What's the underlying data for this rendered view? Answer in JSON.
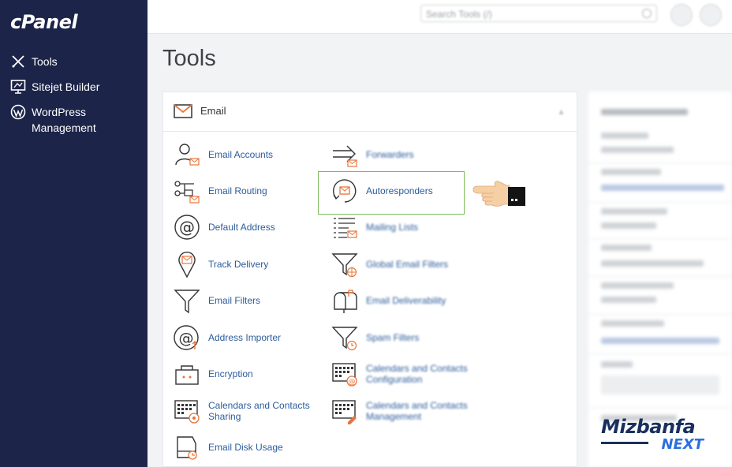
{
  "brand": {
    "logo": "cPanel"
  },
  "sidebar": {
    "items": [
      {
        "label": "Tools",
        "icon": "tools-icon"
      },
      {
        "label": "Sitejet Builder",
        "icon": "monitor-icon"
      },
      {
        "label": "WordPress Management",
        "icon": "wordpress-icon"
      }
    ]
  },
  "topbar": {
    "search_placeholder": "Search Tools (/)"
  },
  "page": {
    "title": "Tools"
  },
  "section": {
    "title": "Email",
    "tools_left": [
      {
        "label": "Email Accounts",
        "icon": "email-accounts-icon"
      },
      {
        "label": "Email Routing",
        "icon": "email-routing-icon"
      },
      {
        "label": "Default Address",
        "icon": "at-sign-icon"
      },
      {
        "label": "Track Delivery",
        "icon": "location-pin-icon"
      },
      {
        "label": "Email Filters",
        "icon": "funnel-icon"
      },
      {
        "label": "Address Importer",
        "icon": "address-importer-icon"
      },
      {
        "label": "Encryption",
        "icon": "lock-icon"
      },
      {
        "label": "Calendars and Contacts Sharing",
        "icon": "calendar-sharing-icon"
      },
      {
        "label": "Email Disk Usage",
        "icon": "disk-usage-icon"
      }
    ],
    "tools_right": [
      {
        "label": "Forwarders",
        "icon": "forwarders-icon"
      },
      {
        "label": "Autoresponders",
        "icon": "autoresponders-icon"
      },
      {
        "label": "Mailing Lists",
        "icon": "mailing-lists-icon"
      },
      {
        "label": "Global Email Filters",
        "icon": "global-filter-icon"
      },
      {
        "label": "Email Deliverability",
        "icon": "mailbox-icon"
      },
      {
        "label": "Spam Filters",
        "icon": "spam-filter-icon"
      },
      {
        "label": "Calendars and Contacts Configuration",
        "icon": "calendar-config-icon"
      },
      {
        "label": "Calendars and Contacts Management",
        "icon": "calendar-management-icon"
      }
    ]
  },
  "watermark": {
    "top": "Mizbanfa",
    "bottom": "NEXT"
  },
  "colors": {
    "sidebar": "#1c2449",
    "link": "#2d5c9c",
    "accent": "#e8743b",
    "highlight": "#7dbb59"
  }
}
